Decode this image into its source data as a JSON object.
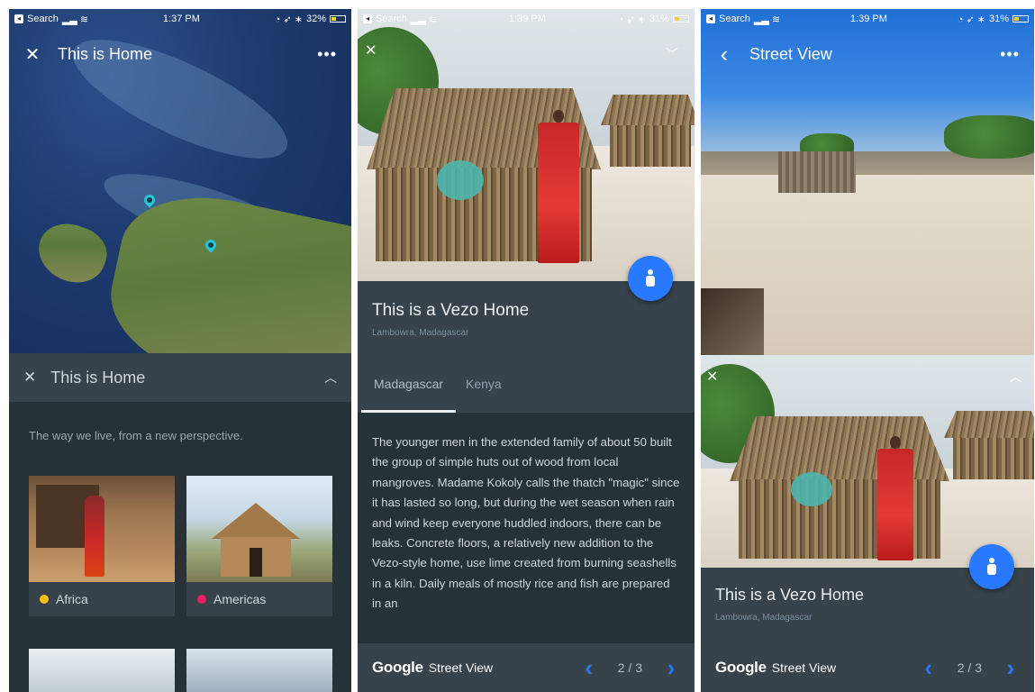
{
  "panel_left": {
    "status": {
      "carrier": "Search",
      "time": "1:37 PM",
      "battery": "32%"
    },
    "topbar": {
      "title": "This is Home"
    },
    "sheet": {
      "title": "This is Home",
      "tagline": "The way we live, from a new perspective.",
      "cards": [
        {
          "label": "Africa",
          "dot_color": "#f4c20d"
        },
        {
          "label": "Americas",
          "dot_color": "#e91e63"
        }
      ]
    }
  },
  "panel_middle": {
    "status": {
      "carrier": "Search",
      "time": "1:39 PM",
      "battery": "31%"
    },
    "info": {
      "title": "This is a Vezo Home",
      "location": "Lambowra, Madagascar"
    },
    "tabs": [
      {
        "label": "Madagascar",
        "active": true
      },
      {
        "label": "Kenya",
        "active": false
      }
    ],
    "article": "The younger men in the extended family of about 50 built the group of simple huts out of wood from local mangroves. Madame Kokoly calls the thatch \"magic\" since it has lasted so long, but during the wet season when rain and wind keep everyone huddled indoors, there can be leaks. Concrete floors, a relatively new addition to the Vezo-style home, use lime created from burning seashells in a kiln. Daily meals of mostly rice and fish are prepared in an",
    "footer": {
      "brand": "Google",
      "product": "Street View",
      "page": "2 / 3"
    }
  },
  "panel_right": {
    "status": {
      "carrier": "Search",
      "time": "1:39 PM",
      "battery": "31%"
    },
    "topbar": {
      "title": "Street View"
    },
    "info": {
      "title": "This is a Vezo Home",
      "location": "Lambowra, Madagascar"
    },
    "footer": {
      "brand": "Google",
      "product": "Street View",
      "page": "2 / 3"
    }
  },
  "colors": {
    "accent": "#2979ff",
    "panel_bg": "#263238",
    "card_bg": "#37424a"
  },
  "icons": [
    "close-icon",
    "more-icon",
    "chevron-up-icon",
    "chevron-down-icon",
    "back-arrow-icon",
    "pegman-icon",
    "chevron-left-icon",
    "chevron-right-icon",
    "map-pin-icon"
  ]
}
